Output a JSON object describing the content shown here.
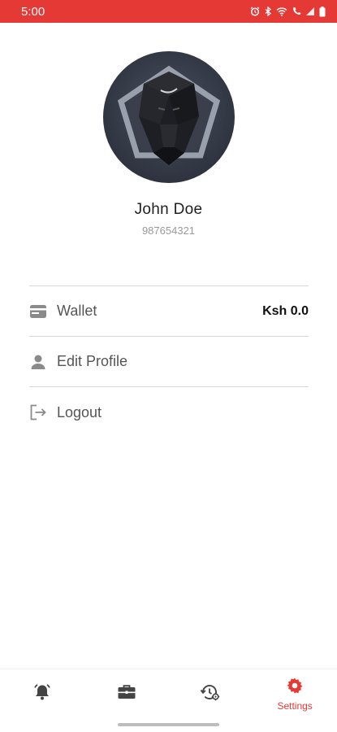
{
  "status_bar": {
    "time": "5:00",
    "icons": [
      "alarm-icon",
      "bluetooth-icon",
      "wifi-icon",
      "call-icon",
      "signal-icon",
      "battery-icon"
    ]
  },
  "profile": {
    "name": "John Doe",
    "phone": "987654321",
    "avatar": "lion-avatar"
  },
  "menu": {
    "items": [
      {
        "label": "Wallet",
        "value": "Ksh 0.0",
        "icon": "wallet-icon"
      },
      {
        "label": "Edit Profile",
        "icon": "person-icon"
      },
      {
        "label": "Logout",
        "icon": "logout-icon"
      }
    ]
  },
  "bottom_nav": {
    "items": [
      {
        "icon": "bell-icon",
        "label": ""
      },
      {
        "icon": "briefcase-icon",
        "label": ""
      },
      {
        "icon": "history-settings-icon",
        "label": ""
      },
      {
        "icon": "gear-icon",
        "label": "Settings",
        "active": true
      }
    ]
  },
  "colors": {
    "accent": "#e53935",
    "text_muted": "#9a9a9a",
    "divider": "#d8d8d8"
  }
}
